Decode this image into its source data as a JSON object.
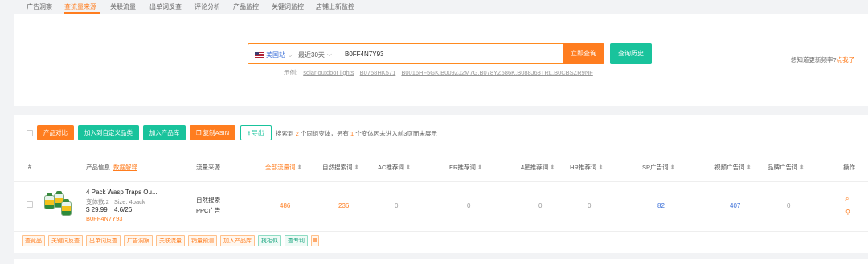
{
  "tabs": [
    "广告洞察",
    "查流量来源",
    "关联流量",
    "出单词反查",
    "评论分析",
    "产品监控",
    "关键词监控",
    "店铺上新监控"
  ],
  "active_tab": 1,
  "search": {
    "market_label": "美国站",
    "period_label": "最近30天",
    "asin_value": "B0FF4N7Y93",
    "query_button": "立即查询",
    "history_button": "查询历史",
    "example_prefix": "示例:",
    "examples": [
      "solar outdoor lights",
      "B0758HK571",
      "B0016HF5GK,B009ZJ2M7G,B078YZ586K,B088J68TRL,B0CBSZR9NF"
    ]
  },
  "right_hint": {
    "text": "想知道更新频率?",
    "link": "点我了"
  },
  "toolbar": {
    "compare": "产品对比",
    "add_custom": "加入到自定义品类",
    "add_library": "加入产品库",
    "copy_asin": "复制ASIN",
    "export": "导出",
    "summary_parts": [
      "搜索到",
      "2",
      "个同组变体，另有",
      "1",
      "个变体因未进入前3页而未展示"
    ]
  },
  "columns": {
    "index": "#",
    "product_info": "产品信息",
    "data_explain": "数据解释",
    "traffic_source": "流量来源",
    "all_traffic": "全部流量词",
    "organic": "自然搜索词",
    "ac": "AC推荐词",
    "er": "ER推荐词",
    "four_star": "4星推荐词",
    "hr": "HR推荐词",
    "sp": "SP广告词",
    "video": "视频广告词",
    "brand": "品牌广告词",
    "action": "操作"
  },
  "row": {
    "title": "4 Pack Wasp Traps Ou...",
    "variants": "变体数:2",
    "size": "Size: 4pack",
    "price": "$ 29.99",
    "rating": "4.6/26",
    "asin": "B0FF4N7Y93",
    "sources": [
      "自然搜索",
      "PPC广告"
    ],
    "all_traffic": "486",
    "organic": "236",
    "ac": "0",
    "er": "0",
    "four_star": "0",
    "hr": "0",
    "sp": "82",
    "video": "407",
    "brand": "0"
  },
  "row_tags": [
    "查竞品",
    "关键词反查",
    "出单词反查",
    "广告洞察",
    "关联流量",
    "销量预测",
    "加入产品库",
    "找相似",
    "查专利"
  ],
  "colors": {
    "accent": "#ff7d1f",
    "green": "#19c39c",
    "blue": "#3b6fd8"
  },
  "icons": {
    "search": "search-icon",
    "location": "location-pin-icon",
    "export": "download-icon",
    "copy": "copy-icon"
  }
}
